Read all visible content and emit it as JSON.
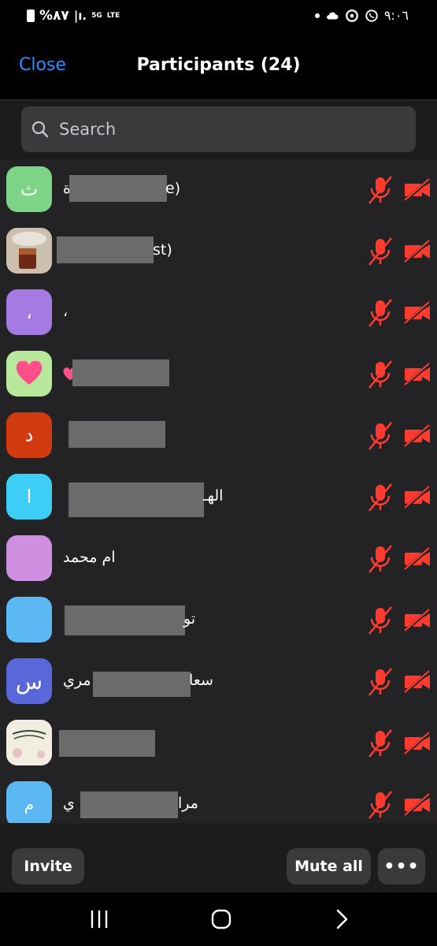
{
  "status_bar": {
    "battery": "%٨٧",
    "network": "5G",
    "lte": "LTE",
    "time": "٩:٠٦"
  },
  "header": {
    "close_label": "Close",
    "title": "Participants (24)"
  },
  "search": {
    "placeholder": "Search"
  },
  "participants": [
    {
      "avatar_text": "ث",
      "avatar_color": "#7dd487",
      "name_visible": "ة",
      "name_tail": "e)",
      "mic": "muted",
      "video": "off"
    },
    {
      "avatar_text": "",
      "avatar_color": "#c9b8a0",
      "name_visible": "",
      "name_tail": "st)",
      "mic": "muted",
      "video": "off"
    },
    {
      "avatar_text": "،",
      "avatar_color": "#a57ae2",
      "name_visible": "،",
      "name_tail": "",
      "mic": "muted",
      "video": "off"
    },
    {
      "avatar_text": "❤",
      "avatar_color": "#b8e89c",
      "name_visible": "",
      "name_tail": "",
      "mic": "muted",
      "video": "off"
    },
    {
      "avatar_text": "د",
      "avatar_color": "#d23a10",
      "name_visible": "",
      "name_tail": "",
      "mic": "muted",
      "video": "off"
    },
    {
      "avatar_text": "ا",
      "avatar_color": "#3dcdf5",
      "name_visible": "",
      "name_tail": "الهـ",
      "mic": "muted",
      "video": "off"
    },
    {
      "avatar_text": "",
      "avatar_color": "#cf8fe0",
      "name_visible": "ام محمد",
      "name_tail": "",
      "mic": "muted",
      "video": "off"
    },
    {
      "avatar_text": "",
      "avatar_color": "#5bb8f2",
      "name_visible": "",
      "name_tail": "تو",
      "mic": "muted",
      "video": "off"
    },
    {
      "avatar_text": "س",
      "avatar_color": "#5a67d8",
      "name_visible": "مري",
      "name_tail": "سعا",
      "mic": "muted",
      "video": "off"
    },
    {
      "avatar_text": "",
      "avatar_color": "#f1ede0",
      "name_visible": "",
      "name_tail": "",
      "mic": "muted",
      "video": "off"
    },
    {
      "avatar_text": "م",
      "avatar_color": "#5bb8f2",
      "name_visible": "ي",
      "name_tail": "مرا",
      "mic": "muted",
      "video": "off"
    }
  ],
  "toolbar": {
    "invite_label": "Invite",
    "mute_all_label": "Mute all",
    "more_label": "•••"
  },
  "colors": {
    "accent": "#2d8cff",
    "muted_red": "#ff3b30"
  }
}
